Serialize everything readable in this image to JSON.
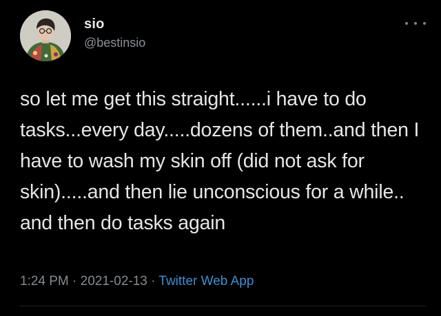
{
  "author": {
    "display_name": "sio",
    "handle": "@bestinsio"
  },
  "tweet": {
    "text": "so let me get this straight......i have to do tasks...every day.....dozens of them..and then I have to wash my skin off (did not ask for skin).....and then lie unconscious for a while.. and then do tasks again",
    "time": "1:24 PM",
    "date": "2021-02-13",
    "separator": "·",
    "source": "Twitter Web App"
  },
  "icons": {
    "more": "more-horizontal-icon",
    "avatar": "profile-picture"
  },
  "colors": {
    "background": "#000000",
    "link": "#3b8fd6",
    "secondary_text": "#858b92"
  }
}
